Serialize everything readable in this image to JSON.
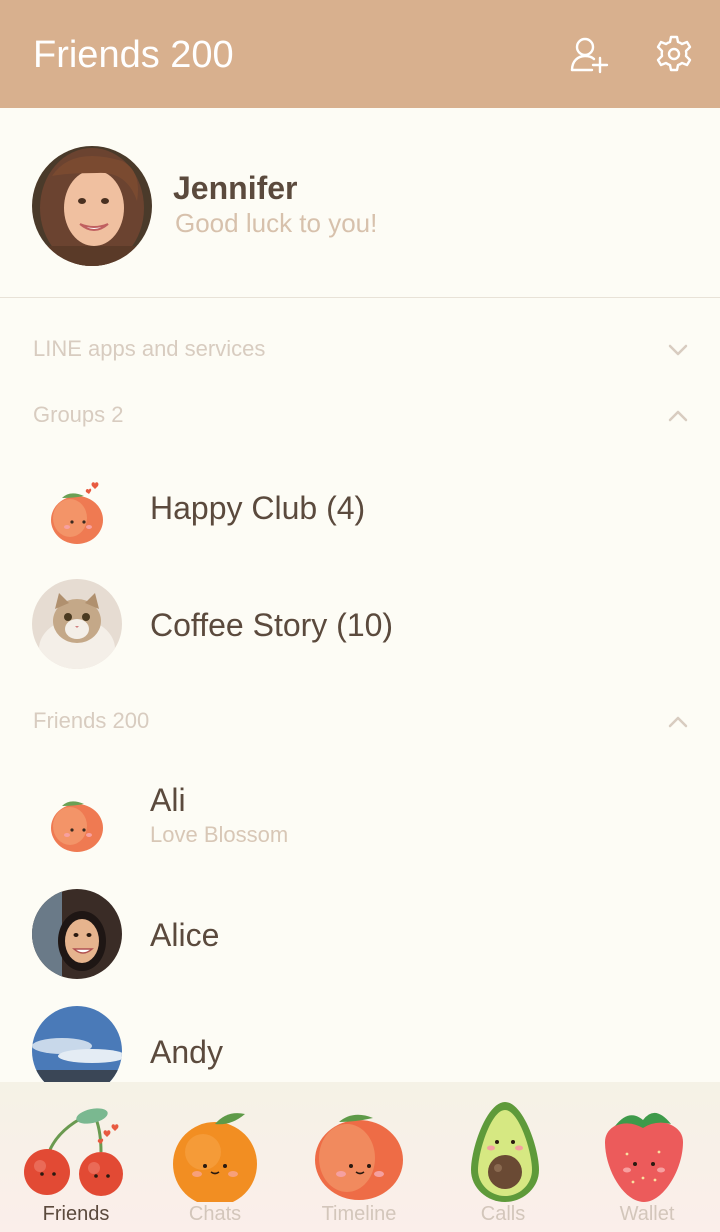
{
  "header": {
    "title": "Friends 200",
    "add_friend_icon": "add-friend-icon",
    "settings_icon": "gear-icon",
    "bg_color": "#d8b08e"
  },
  "profile": {
    "name": "Jennifer",
    "status": "Good luck to you!"
  },
  "sections": {
    "apps": {
      "label": "LINE apps and services",
      "expanded": false
    },
    "groups": {
      "label": "Groups 2",
      "expanded": true
    },
    "friends": {
      "label": "Friends 200",
      "expanded": true
    }
  },
  "groups": [
    {
      "name": "Happy Club (4)",
      "avatar": "peach-avatar"
    },
    {
      "name": "Coffee Story (10)",
      "avatar": "cat-avatar"
    }
  ],
  "friends": [
    {
      "name": "Ali",
      "status": "Love Blossom",
      "avatar": "peach-avatar"
    },
    {
      "name": "Alice",
      "status": "",
      "avatar": "photo-avatar"
    },
    {
      "name": "Andy",
      "status": "",
      "avatar": "sky-avatar"
    }
  ],
  "tabs": [
    {
      "label": "Friends",
      "icon": "cherry-icon",
      "active": true
    },
    {
      "label": "Chats",
      "icon": "orange-icon",
      "active": false
    },
    {
      "label": "Timeline",
      "icon": "peach-icon",
      "active": false
    },
    {
      "label": "Calls",
      "icon": "avocado-icon",
      "active": false
    },
    {
      "label": "Wallet",
      "icon": "strawberry-icon",
      "active": false
    }
  ]
}
